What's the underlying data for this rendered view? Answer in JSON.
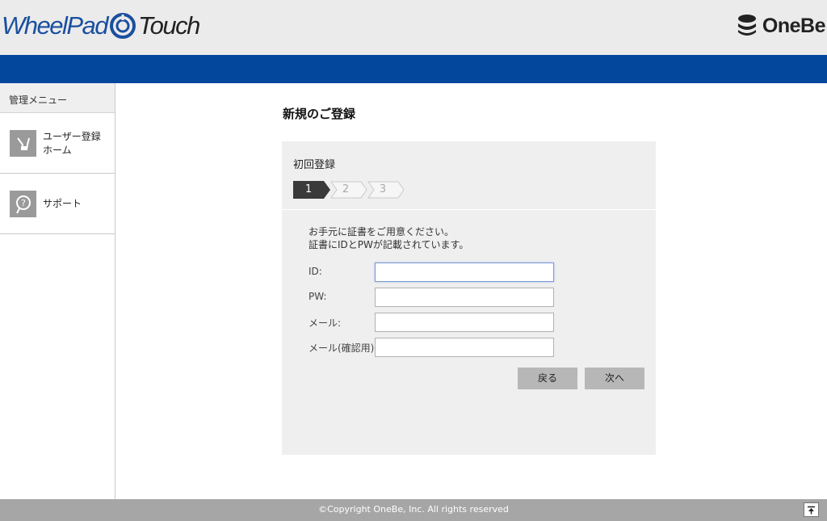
{
  "header": {
    "logo_part1": "WheelPad",
    "logo_part2": "Touch",
    "brand": "OneBe"
  },
  "sidebar": {
    "heading": "管理メニュー",
    "items": [
      {
        "label_line1": "ユーザー登録",
        "label_line2": "ホーム",
        "icon": "user-registration-icon"
      },
      {
        "label_line1": "サポート",
        "icon": "support-icon"
      }
    ]
  },
  "main": {
    "title": "新規のご登録",
    "panel_title": "初回登録",
    "steps": [
      "1",
      "2",
      "3"
    ],
    "active_step": 1,
    "description_line1": "お手元に証書をご用意ください。",
    "description_line2": "証書にIDとPWが記載されています。",
    "fields": [
      {
        "label": "ID:",
        "value": ""
      },
      {
        "label": "PW:",
        "value": ""
      },
      {
        "label": "メール:",
        "value": ""
      },
      {
        "label": "メール(確認用):",
        "value": ""
      }
    ],
    "back_button": "戻る",
    "next_button": "次へ"
  },
  "footer": {
    "copyright": "©Copyright OneBe, Inc. All rights reserved",
    "to_top_icon": "arrow-up-to-top-icon"
  },
  "colors": {
    "blue_bar": "#03479d",
    "logo_blue": "#1a4fa0",
    "panel_bg": "#efefef",
    "button_bg": "#b7b7b7",
    "footer_bg": "#a6a6a6",
    "step_active": "#3a3a3a"
  }
}
